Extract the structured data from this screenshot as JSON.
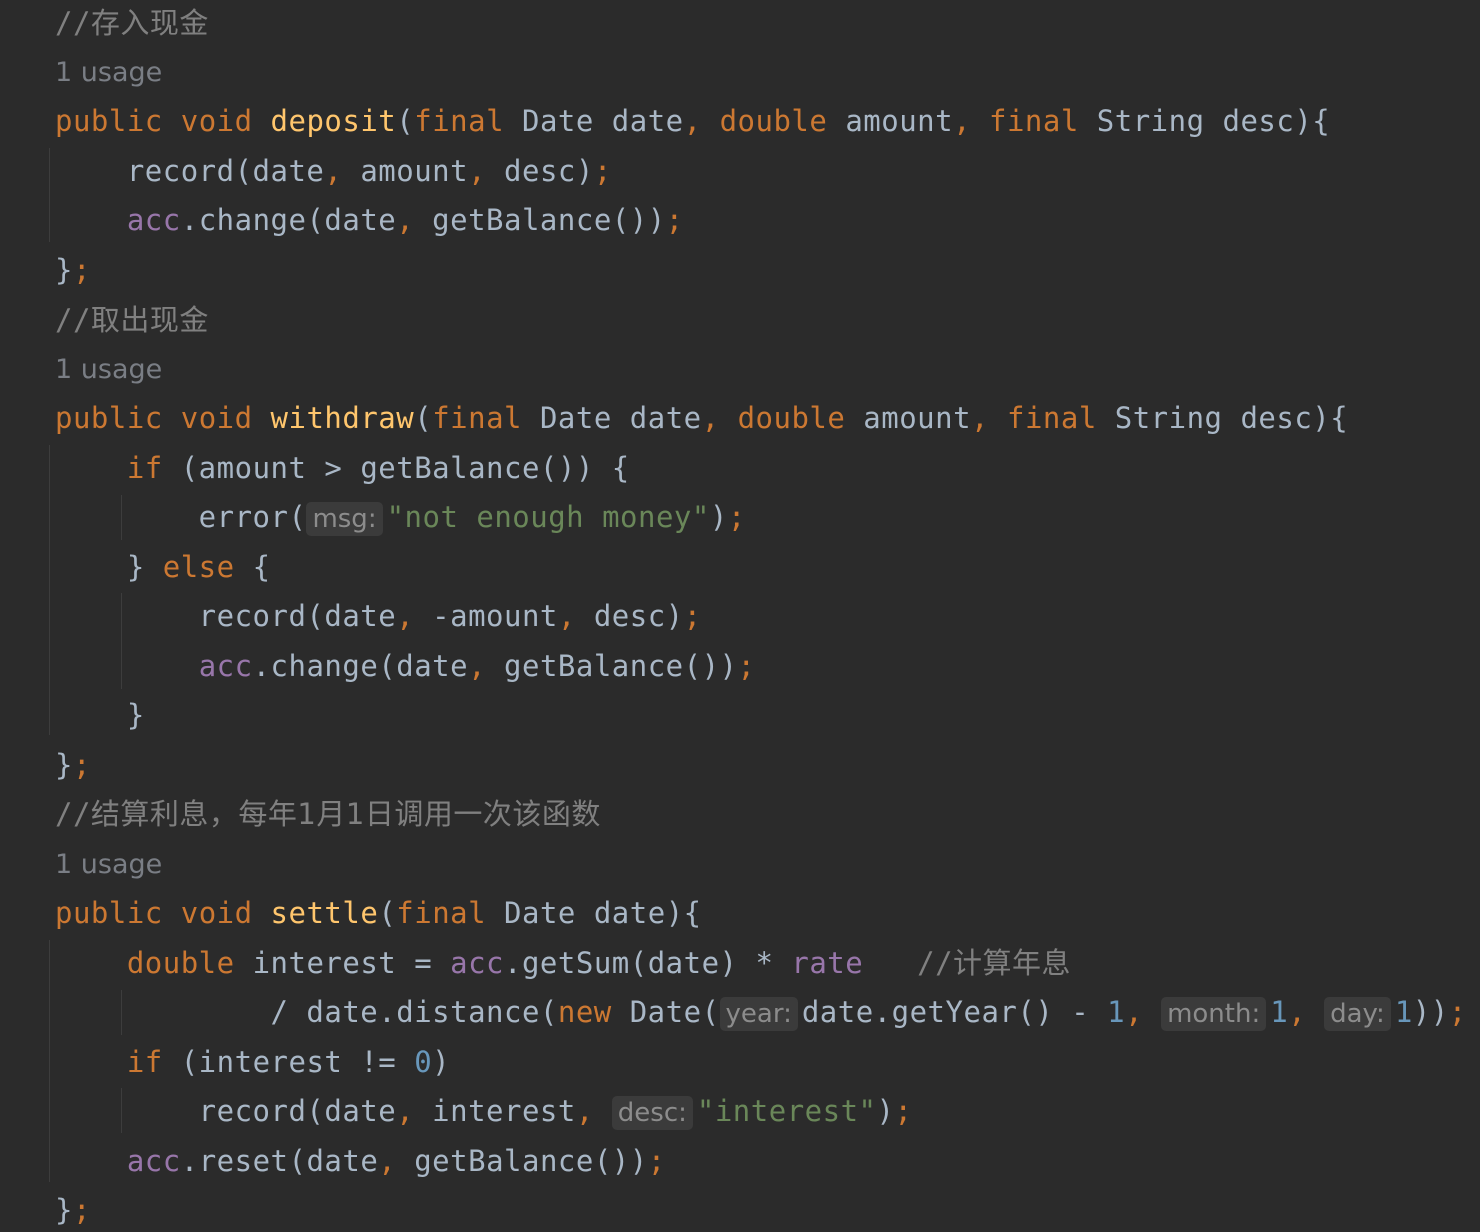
{
  "editor": {
    "usage_hint": "1 usage",
    "param_hints": {
      "msg": "msg:",
      "year": "year:",
      "month": "month:",
      "day": "day:",
      "desc": "desc:"
    },
    "comments": {
      "deposit": "//存入现金",
      "withdraw": "//取出现金",
      "settle": "//结算利息，每年1月1日调用一次该函数",
      "interest_calc": "//计算年息"
    },
    "functions": {
      "deposit": "deposit",
      "withdraw": "withdraw",
      "settle": "settle"
    },
    "strings": {
      "not_enough": "\"not enough money\"",
      "interest": "\"interest\""
    },
    "colors": {
      "background": "#2b2b2b",
      "keyword": "#cc7832",
      "function": "#ffc66d",
      "string": "#6a8759",
      "number": "#6897bb",
      "field": "#9876aa",
      "comment": "#808080",
      "text": "#a9b7c6"
    }
  }
}
